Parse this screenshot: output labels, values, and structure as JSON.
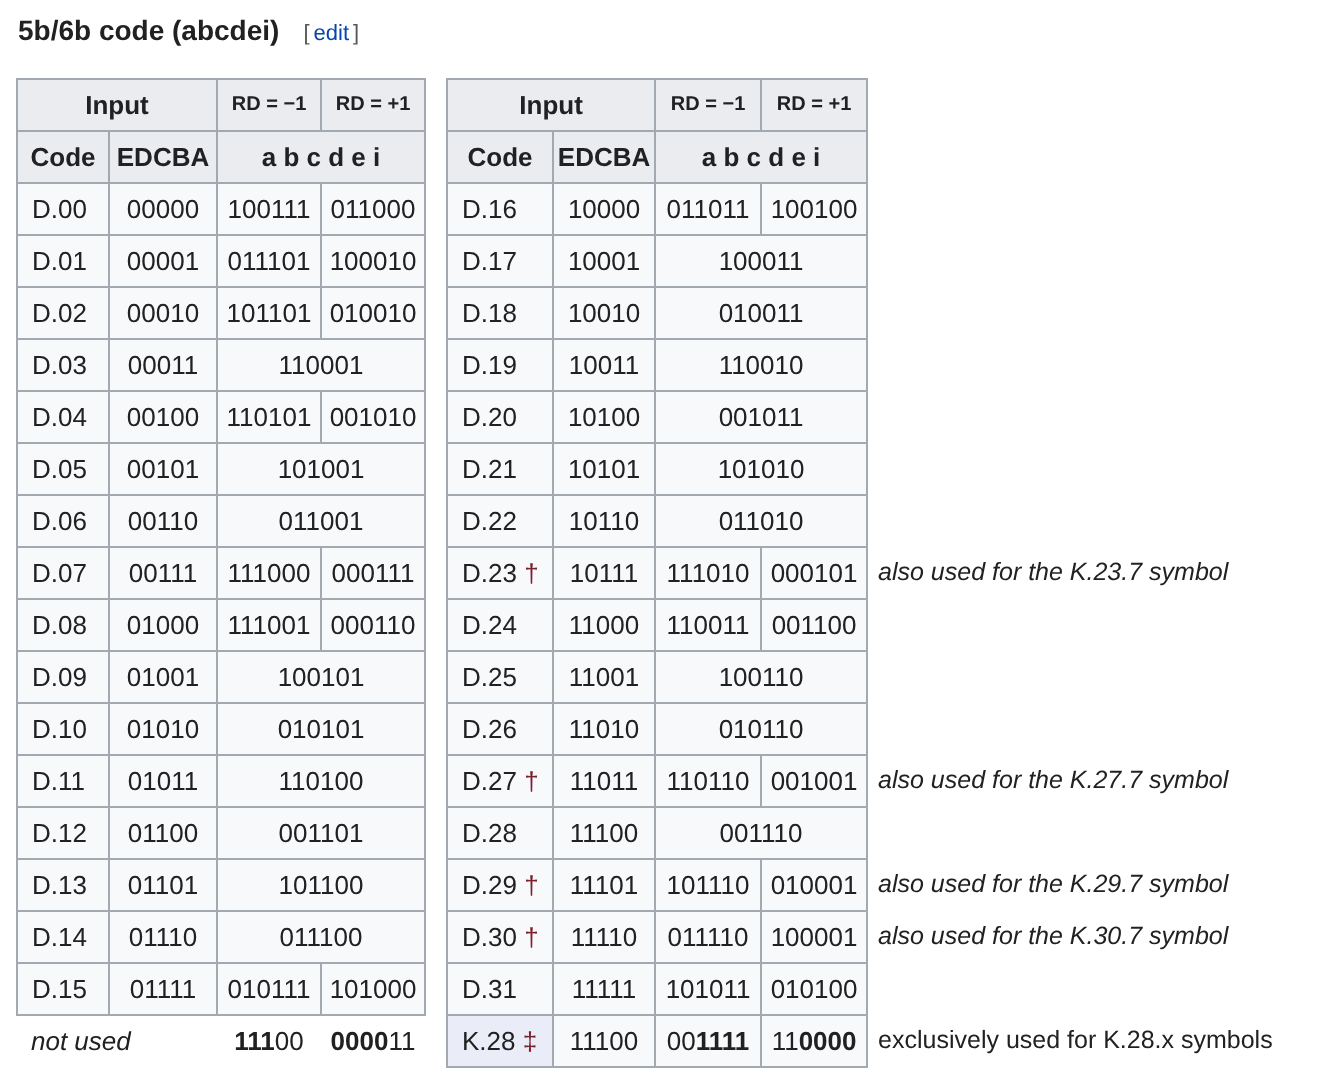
{
  "heading": {
    "title": "5b/6b code (abcdei)",
    "edit_open": "[",
    "edit_label": "edit",
    "edit_close": "]"
  },
  "tables": [
    {
      "header": {
        "input": "Input",
        "rd_minus": "RD = −1",
        "rd_plus": "RD = +1",
        "code": "Code",
        "edcba": "EDCBA",
        "bits": "a b c d e i"
      },
      "rows": [
        {
          "kind": "data",
          "code": "D.00",
          "input": "00000",
          "rd_minus": "100111",
          "rd_plus": "011000"
        },
        {
          "kind": "data",
          "code": "D.01",
          "input": "00001",
          "rd_minus": "011101",
          "rd_plus": "100010"
        },
        {
          "kind": "data",
          "code": "D.02",
          "input": "00010",
          "rd_minus": "101101",
          "rd_plus": "010010"
        },
        {
          "kind": "data",
          "code": "D.03",
          "input": "00011",
          "both": "110001"
        },
        {
          "kind": "data",
          "code": "D.04",
          "input": "00100",
          "rd_minus": "110101",
          "rd_plus": "001010"
        },
        {
          "kind": "data",
          "code": "D.05",
          "input": "00101",
          "both": "101001"
        },
        {
          "kind": "data",
          "code": "D.06",
          "input": "00110",
          "both": "011001"
        },
        {
          "kind": "data",
          "code": "D.07",
          "input": "00111",
          "rd_minus": "111000",
          "rd_plus": "000111"
        },
        {
          "kind": "data",
          "code": "D.08",
          "input": "01000",
          "rd_minus": "111001",
          "rd_plus": "000110"
        },
        {
          "kind": "data",
          "code": "D.09",
          "input": "01001",
          "both": "100101"
        },
        {
          "kind": "data",
          "code": "D.10",
          "input": "01010",
          "both": "010101"
        },
        {
          "kind": "data",
          "code": "D.11",
          "input": "01011",
          "both": "110100"
        },
        {
          "kind": "data",
          "code": "D.12",
          "input": "01100",
          "both": "001101"
        },
        {
          "kind": "data",
          "code": "D.13",
          "input": "01101",
          "both": "101100"
        },
        {
          "kind": "data",
          "code": "D.14",
          "input": "01110",
          "both": "011100"
        },
        {
          "kind": "data",
          "code": "D.15",
          "input": "01111",
          "rd_minus": "010111",
          "rd_plus": "101000"
        },
        {
          "kind": "unused",
          "label": "not used",
          "rd_minus": "**111**00",
          "rd_plus": "**0000**11"
        }
      ]
    },
    {
      "header": {
        "input": "Input",
        "rd_minus": "RD = −1",
        "rd_plus": "RD = +1",
        "code": "Code",
        "edcba": "EDCBA",
        "bits": "a b c d e i"
      },
      "rows": [
        {
          "kind": "data",
          "code": "D.16",
          "input": "10000",
          "rd_minus": "011011",
          "rd_plus": "100100"
        },
        {
          "kind": "data",
          "code": "D.17",
          "input": "10001",
          "both": "100011"
        },
        {
          "kind": "data",
          "code": "D.18",
          "input": "10010",
          "both": "010011"
        },
        {
          "kind": "data",
          "code": "D.19",
          "input": "10011",
          "both": "110010"
        },
        {
          "kind": "data",
          "code": "D.20",
          "input": "10100",
          "both": "001011"
        },
        {
          "kind": "data",
          "code": "D.21",
          "input": "10101",
          "both": "101010"
        },
        {
          "kind": "data",
          "code": "D.22",
          "input": "10110",
          "both": "011010"
        },
        {
          "kind": "data",
          "code": "D.23",
          "mark": "†",
          "input": "10111",
          "rd_minus": "111010",
          "rd_plus": "000101",
          "note": "also used for the K.23.7 symbol"
        },
        {
          "kind": "data",
          "code": "D.24",
          "input": "11000",
          "rd_minus": "110011",
          "rd_plus": "001100"
        },
        {
          "kind": "data",
          "code": "D.25",
          "input": "11001",
          "both": "100110"
        },
        {
          "kind": "data",
          "code": "D.26",
          "input": "11010",
          "both": "010110"
        },
        {
          "kind": "data",
          "code": "D.27",
          "mark": "†",
          "input": "11011",
          "rd_minus": "110110",
          "rd_plus": "001001",
          "note": "also used for the K.27.7 symbol"
        },
        {
          "kind": "data",
          "code": "D.28",
          "input": "11100",
          "both": "001110"
        },
        {
          "kind": "data",
          "code": "D.29",
          "mark": "†",
          "input": "11101",
          "rd_minus": "101110",
          "rd_plus": "010001",
          "note": "also used for the K.29.7 symbol"
        },
        {
          "kind": "data",
          "code": "D.30",
          "mark": "†",
          "input": "11110",
          "rd_minus": "011110",
          "rd_plus": "100001",
          "note": "also used for the K.30.7 symbol"
        },
        {
          "kind": "data",
          "code": "D.31",
          "input": "11111",
          "rd_minus": "101011",
          "rd_plus": "010100"
        },
        {
          "kind": "special",
          "code": "K.28",
          "mark": "‡",
          "input": "11100",
          "rd_minus": "00**1111**",
          "rd_plus": "11**0000**",
          "note": "exclusively used for K.28.x symbols"
        }
      ]
    }
  ]
}
